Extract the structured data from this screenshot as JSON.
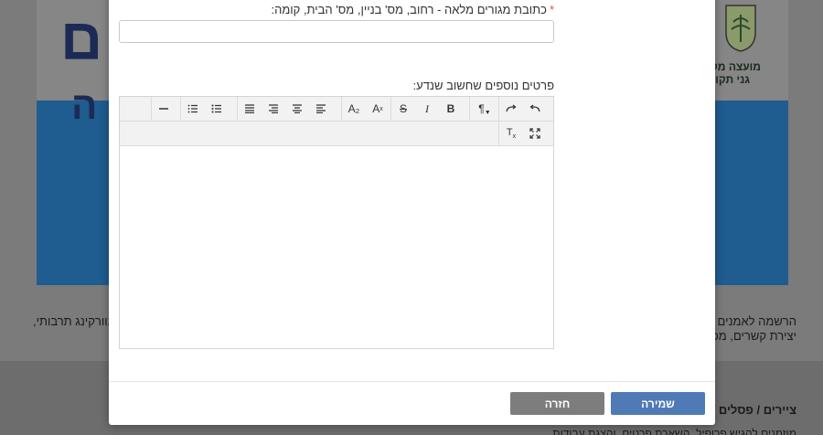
{
  "background": {
    "banner_big_text": "ם",
    "banner_sub_text": "ה",
    "logo_title": "מועצה מקו",
    "logo_sub": "גני תקוו",
    "paragraph_right_line1": "הרשמה לאמנים ב",
    "paragraph_right_line2": "יצירת קשרים, מכ",
    "paragraph_left_line1": "נוורקינג תרבותי,",
    "category_text": "ציירים / פסלים / צ",
    "bottom_text": "מוזמנים להגיש פרופיל, השארת פרטים, והצגת עבודות"
  },
  "modal": {
    "address_label": "כתובת מגורים מלאה - רחוב, מס' בניין, מס' הבית, קומה:",
    "address_required": "*",
    "address_value": "",
    "details_label": "פרטים נוספים שחשוב שנדע:",
    "editor_content": "",
    "toolbar": {
      "undo": "undo-icon",
      "redo": "redo-icon",
      "paragraph": "¶",
      "bold": "B",
      "italic": "I",
      "strikethrough": "S",
      "superscript": "A",
      "subscript": "A₂",
      "align_left": "align-left-icon",
      "align_center": "align-center-icon",
      "align_right": "align-right-icon",
      "justify": "justify-icon",
      "bulleted_list": "bullet-list-icon",
      "numbered_list": "numbered-list-icon",
      "horizontal_rule": "horizontal-rule-icon",
      "fullscreen": "fullscreen-icon",
      "clear_format": "Tx"
    },
    "buttons": {
      "save": "שמירה",
      "back": "חזרה"
    }
  }
}
